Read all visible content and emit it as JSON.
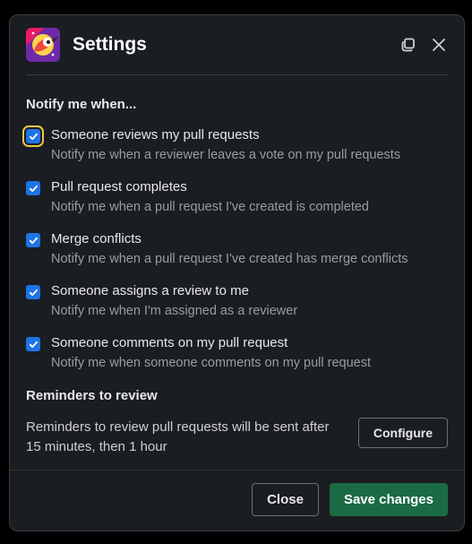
{
  "header": {
    "title": "Settings"
  },
  "notify": {
    "heading": "Notify me when...",
    "options": [
      {
        "label": "Someone reviews my pull requests",
        "description": "Notify me when a reviewer leaves a vote on my pull requests",
        "checked": true,
        "focused": true
      },
      {
        "label": "Pull request completes",
        "description": "Notify me when a pull request I've created is completed",
        "checked": true,
        "focused": false
      },
      {
        "label": "Merge conflicts",
        "description": "Notify me when a pull request I've created has merge conflicts",
        "checked": true,
        "focused": false
      },
      {
        "label": "Someone assigns a review to me",
        "description": "Notify me when I'm assigned as a reviewer",
        "checked": true,
        "focused": false
      },
      {
        "label": "Someone comments on my pull request",
        "description": "Notify me when someone comments on my pull request",
        "checked": true,
        "focused": false
      }
    ]
  },
  "reminders": {
    "heading": "Reminders to review",
    "text": "Reminders to review pull requests will be sent after 15 minutes, then 1 hour",
    "configure_label": "Configure"
  },
  "footer": {
    "close_label": "Close",
    "save_label": "Save changes"
  }
}
